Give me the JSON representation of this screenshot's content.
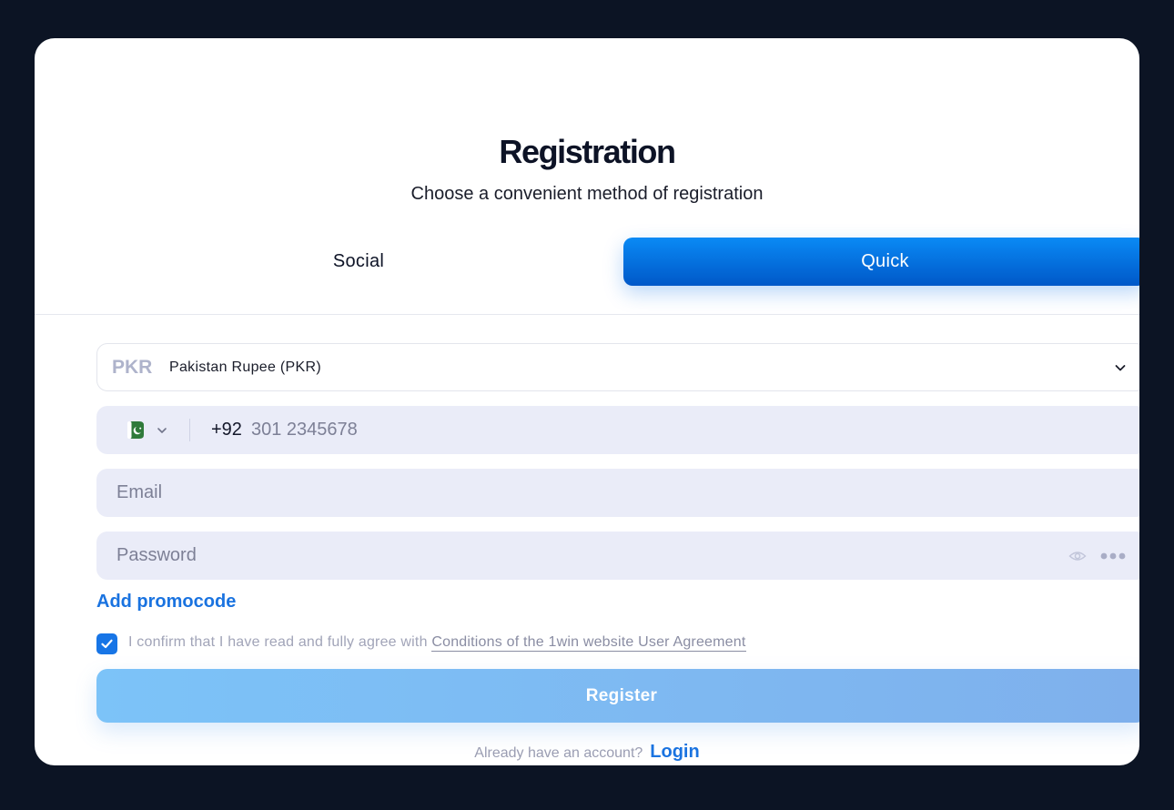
{
  "registration": {
    "title": "Registration",
    "subtitle": "Choose a convenient method of registration",
    "tabs": [
      {
        "label": "Social",
        "active": false
      },
      {
        "label": "Quick",
        "active": true
      }
    ],
    "currency": {
      "code": "PKR",
      "name": "Pakistan Rupee (PKR)",
      "icon": "chevron-down-icon"
    },
    "phone": {
      "country_icon": "pakistan-flag-icon",
      "dial_code": "+92",
      "placeholder": "301 2345678"
    },
    "email": {
      "placeholder": "Email"
    },
    "password": {
      "placeholder": "Password",
      "icons": [
        "eye-icon",
        "more-icon"
      ]
    },
    "promo_label": "Add promocode",
    "agreement": {
      "checked": true,
      "text": "I confirm that I have read and fully agree with",
      "link_text": "Conditions of the 1win website User Agreement"
    },
    "register_label": "Register",
    "login_prompt": "Already have an account?",
    "login_label": "Login"
  },
  "colors": {
    "page_background": "#0c1424",
    "accent": "#0a6fe0",
    "input_background": "#eaecf8",
    "register_button": "#7cc3f8"
  }
}
